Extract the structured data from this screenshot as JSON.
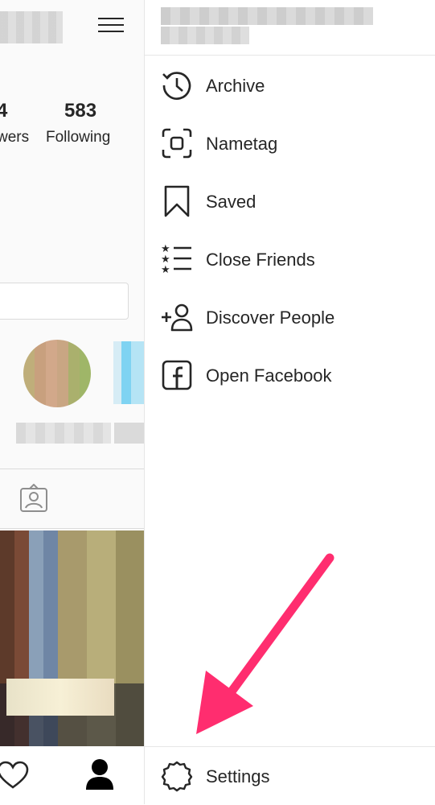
{
  "profile": {
    "followers_count_partial": "4",
    "followers_label_partial": "wers",
    "following_count": "583",
    "following_label": "Following"
  },
  "drawer": {
    "items": [
      {
        "label": "Archive",
        "icon": "archive-icon"
      },
      {
        "label": "Nametag",
        "icon": "nametag-icon"
      },
      {
        "label": "Saved",
        "icon": "bookmark-icon"
      },
      {
        "label": "Close Friends",
        "icon": "close-friends-icon"
      },
      {
        "label": "Discover People",
        "icon": "add-person-icon"
      },
      {
        "label": "Open Facebook",
        "icon": "facebook-icon"
      }
    ],
    "settings_label": "Settings"
  },
  "annotation": {
    "arrow_color": "#ff2d6f"
  }
}
